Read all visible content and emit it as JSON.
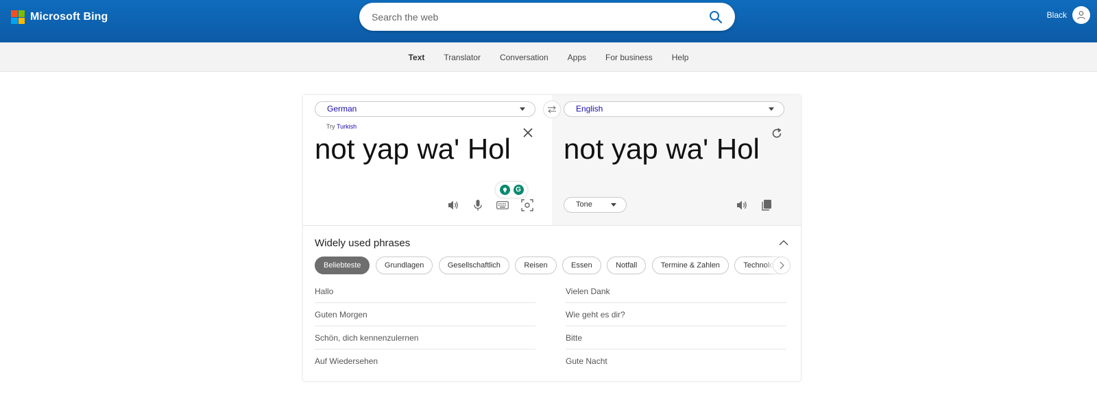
{
  "header": {
    "brand": "Microsoft Bing",
    "logo_colors": [
      "#f25022",
      "#7fba00",
      "#00a4ef",
      "#ffb900"
    ],
    "search_placeholder": "Search the web",
    "user_name": "Black"
  },
  "nav": {
    "items": [
      {
        "label": "Text",
        "active": true
      },
      {
        "label": "Translator",
        "active": false
      },
      {
        "label": "Conversation",
        "active": false
      },
      {
        "label": "Apps",
        "active": false
      },
      {
        "label": "For business",
        "active": false
      },
      {
        "label": "Help",
        "active": false
      }
    ]
  },
  "translator": {
    "source_lang": "German",
    "target_lang": "English",
    "try_prefix": "Try",
    "try_lang": "Turkish",
    "source_text": "not yap wa' Hol",
    "target_text": "not yap wa' Hol",
    "tone_label": "Tone"
  },
  "phrases": {
    "title": "Widely used phrases",
    "categories": [
      {
        "label": "Beliebteste",
        "active": true
      },
      {
        "label": "Grundlagen",
        "active": false
      },
      {
        "label": "Gesellschaftlich",
        "active": false
      },
      {
        "label": "Reisen",
        "active": false
      },
      {
        "label": "Essen",
        "active": false
      },
      {
        "label": "Notfall",
        "active": false
      },
      {
        "label": "Termine & Zahlen",
        "active": false
      },
      {
        "label": "Technologie",
        "active": false
      }
    ],
    "left": [
      "Hallo",
      "Guten Morgen",
      "Schön, dich kennenzulernen",
      "Auf Wiedersehen"
    ],
    "right": [
      "Vielen Dank",
      "Wie geht es dir?",
      "Bitte",
      "Gute Nacht"
    ]
  },
  "accent_color": "#0f6cbd",
  "grammarly_color": "#0a8a6e"
}
